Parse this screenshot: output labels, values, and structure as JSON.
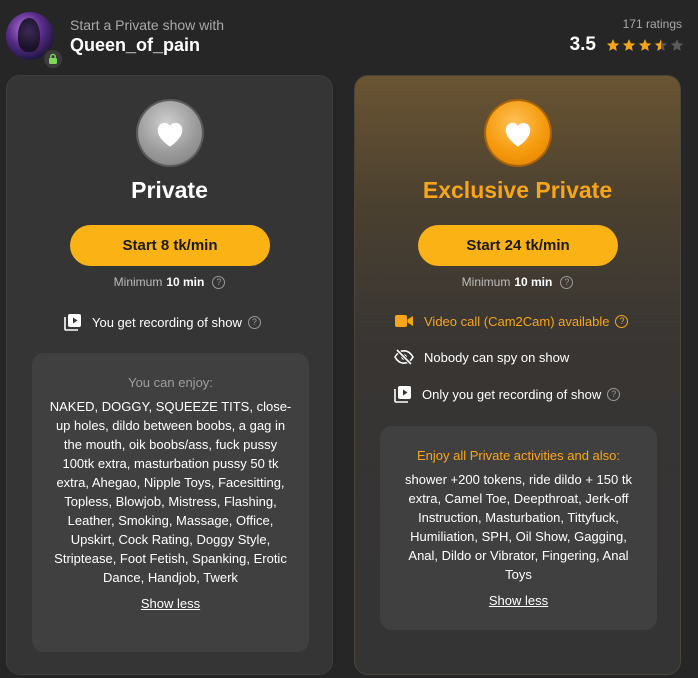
{
  "header": {
    "subtitle": "Start a Private show with",
    "model_name": "Queen_of_pain",
    "ratings_count": "171 ratings",
    "rating_value": "3.5",
    "rating_stars": 3.5,
    "star_color": "#f9a519"
  },
  "private": {
    "title": "Private",
    "start_label": "Start 8 tk/min",
    "minimum_prefix": "Minimum",
    "minimum_value": "10 min",
    "features": [
      {
        "icon": "recording-icon",
        "label": "You get recording of show"
      }
    ],
    "box_heading": "You can enjoy:",
    "box_text": "NAKED, DOGGY, SQUEEZE TITS, close-up holes, dildo between boobs, a gag in the mouth, oik boobs/ass, fuck pussy 100tk extra, masturbation pussy 50 tk extra, Ahegao, Nipple Toys, Facesitting, Topless, Blowjob, Mistress, Flashing, Leather, Smoking, Massage, Office, Upskirt, Cock Rating, Doggy Style, Striptease, Foot Fetish, Spanking, Erotic Dance, Handjob, Twerk",
    "show_less": "Show less"
  },
  "exclusive": {
    "title": "Exclusive Private",
    "start_label": "Start 24 tk/min",
    "minimum_prefix": "Minimum",
    "minimum_value": "10 min",
    "features": [
      {
        "icon": "video-camera-icon",
        "label": "Video call (Cam2Cam) available"
      },
      {
        "icon": "eye-off-icon",
        "label": "Nobody can spy on show"
      },
      {
        "icon": "recording-icon",
        "label": "Only you get recording of show"
      }
    ],
    "box_heading": "Enjoy all Private activities and also:",
    "box_text": "shower +200 tokens, ride dildo + 150 tk extra, Camel Toe, Deepthroat, Jerk-off Instruction, Masturbation, Tittyfuck, Humiliation, SPH, Oil Show, Gagging, Anal, Dildo or Vibrator, Fingering, Anal Toys",
    "show_less": "Show less"
  },
  "colors": {
    "accent": "#fbb214",
    "accent_text": "#f9a519",
    "background": "#262626"
  }
}
